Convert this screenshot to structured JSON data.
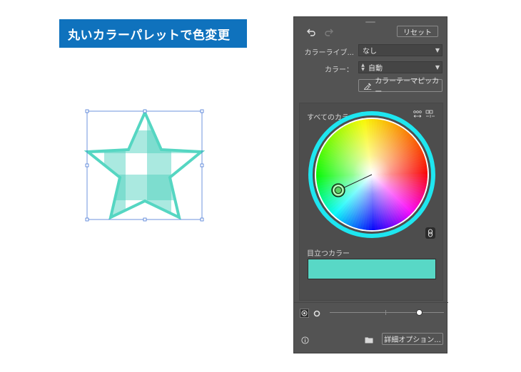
{
  "banner": {
    "title": "丸いカラーパレットで色変更"
  },
  "panel": {
    "reset_label": "リセット",
    "library": {
      "label": "カラーライブ...",
      "value": "なし"
    },
    "colors": {
      "label": "カラー：",
      "value": "自動"
    },
    "theme_picker_label": "カラーテーマピッカー",
    "all_colors_label": "すべてのカラー",
    "prominent_label": "目立つカラー",
    "prominent_color": "#58d8c6",
    "advanced_options_label": "詳細オプション..."
  },
  "colors": {
    "banner": "#0f72bd",
    "star_stroke": "#55d6c2",
    "star_fill_light": "#a5e8de",
    "star_fill_dark": "#7dddcf",
    "wheel_ring": "#1ee6f0",
    "selection": "#4a79d6"
  }
}
